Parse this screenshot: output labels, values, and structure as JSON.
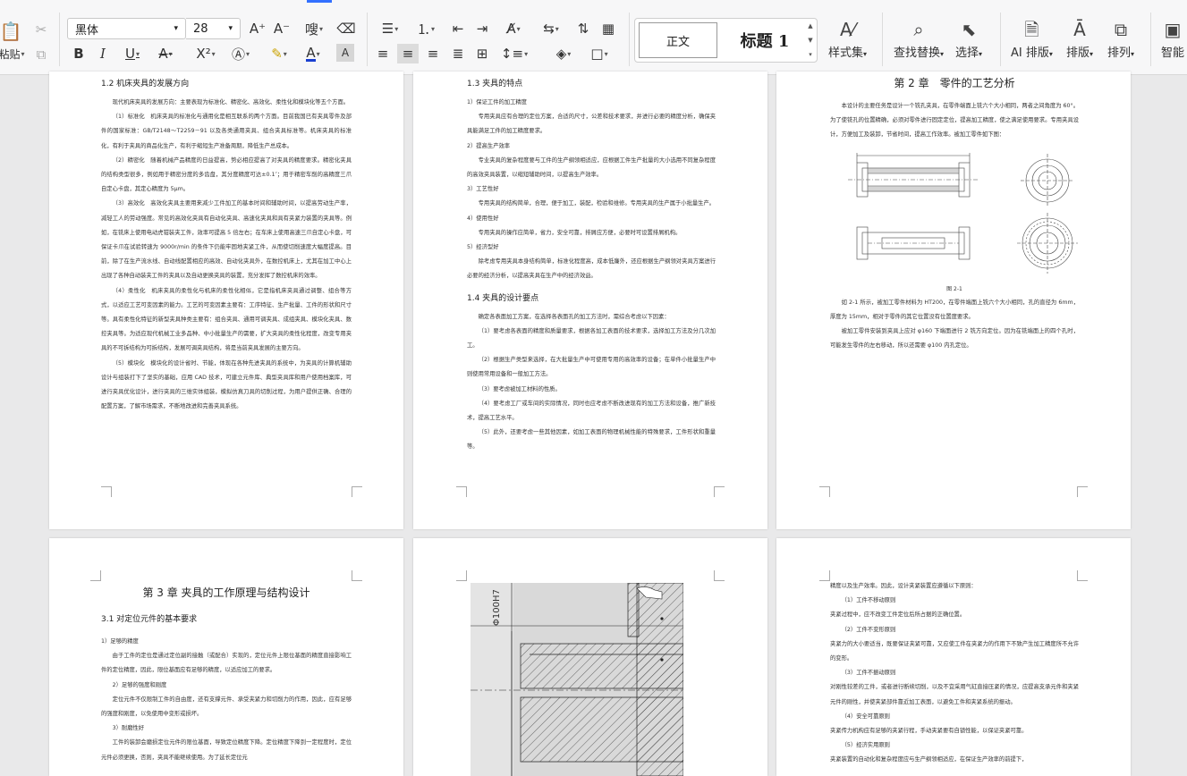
{
  "toolbar": {
    "paste_label": "粘贴",
    "font_name": "黑体",
    "font_size": "28",
    "style_normal": "正文",
    "style_heading1": "标题 1",
    "style_set_label": "样式集",
    "find_replace_label": "查找替换",
    "select_label": "选择",
    "ai_layout_label": "AI 排版",
    "layout_label": "排版",
    "arrange_label": "排列",
    "smart_label": "智能",
    "icons": [
      "cut-icon",
      "copy-icon",
      "font-grow-icon",
      "font-shrink-icon",
      "phonetic-icon",
      "clear-format-icon",
      "bold-icon",
      "italic-icon",
      "underline-icon",
      "strikethrough-icon",
      "superscript-icon",
      "text-effect-icon",
      "highlight-icon",
      "font-color-icon",
      "char-shading-icon",
      "bullet-list-icon",
      "number-list-icon",
      "outdent-icon",
      "indent-icon",
      "text-direction-icon",
      "line-spacing-icon",
      "table-icon",
      "align-left-icon",
      "align-center-icon",
      "align-right-icon",
      "justify-icon",
      "distribute-icon",
      "paragraph-spacing-icon",
      "shading-icon",
      "border-icon"
    ]
  },
  "pages": [
    {
      "id": "p1",
      "heading": "1.2 机床夹具的发展方向",
      "paragraphs": [
        "现代机床夹具的发展方向：主要表现为标准化、精密化、高效化、柔性化和模块化等五个方面。",
        "（1）标准化　机床夹具的标准化与通用化是相互联系的两个方面。目前我国已有夹具零件及部件的国家标准：GB/T2148～T2259－91 以及各类通用夹具、组合夹具标准等。机床夹具的标准化，有利于夹具的商品化生产，有利于缩短生产准备周期，降低生产总成本。",
        "（2）精密化　随着机械产品精度的日益提高，势必相应提高了对夹具的精度要求。精密化夹具的结构类型很多，例如用于精密分度的多齿盘，其分度精度可达±0.1″；用于精密车削的高精度三爪自定心卡盘，其定心精度为 5μm。",
        "（3）高效化　高效化夹具主要用来减少工件加工的基本时间和辅助时间，以提高劳动生产率，减轻工人的劳动强度。常见的高效化夹具有自动化夹具、高速化夹具和具有夹紧力装置的夹具等。例如，在铣床上使用电动虎钳装夹工件，效率可提高 5 倍左右；在车床上使用高速三爪自定心卡盘，可保证卡爪在试验转速为 9000r/min 的条件下仍能牢固地夹紧工件，从而使切削速度大幅度提高。目前，除了在生产流水线、自动线配置相应的高效、自动化夹具外，在数控机床上，尤其在加工中心上出现了各种自动装夹工件的夹具以及自动更换夹具的装置，充分发挥了数控机床的效率。",
        "（4）柔性化　机床夹具的柔性化与机床的柔性化相似，它是指机床夹具通过调整、组合等方式，以适应工艺可变因素的能力。工艺的可变因素主要有：工序特征、生产批量、工件的形状和尺寸等。具有柔性化特征的新型夹具种类主要有：组合夹具、通用可调夹具、成组夹具、模块化夹具、数控夹具等。为适应现代机械工业多品种、中小批量生产的需要，扩大夹具的柔性化程度，改变专用夹具的不可拆结构为可拆结构，发展可调夹具结构，将是当前夹具发展的主要方向。",
        "（5）模块化　模块化的设计省时、节能，体现在各种先进夹具的系统中，为夹具的计算机辅助设计与组装打下了坚实的基础，应用 CAD 技术，可建立元件库、典型夹具库和用户使用档案库，可进行夹具优化设计，进行夹具的三维实体组装，模拟仿真刀具的切削过程，为用户提供正确、合理的配置方案，了解市场需求，不断地改进和完善夹具系统。"
      ]
    },
    {
      "id": "p2",
      "heading": "1.3 夹具的特点",
      "heading2": "1.4 夹具的设计要点",
      "paragraphs": [
        "1）保证工件的加工精度",
        "专用夹具应有合理的定位方案，合适的尺寸，公差和技术要求，并进行必要的精度分析，确保夹具能满足工件的加工精度要求。",
        "2）提高生产效率",
        "专业夹具的复杂程度要与工件的生产纲领相适应，应根据工件生产批量的大小选用不同复杂程度的高效夹具装置，以缩短辅助时间，以提高生产效率。",
        "3）工艺性好",
        "专用夹具的结构简单，合理，便于加工，装配，检验和维修。专用夹具的生产属于小批量生产。",
        "4）使用性好",
        "专用夹具的操作应简单，省力，安全可靠，排屑应方便，必要时可设置排屑机构。",
        "5）经济型好",
        "除考虑专用夹具本身结构简单，标准化程度高，成本低廉外，还应根据生产纲领对夹具方案进行必要的经济分析，以提高夹具在生产中的经济效益。"
      ],
      "paragraphs2": [
        "确定各表面加工方案，在选择各表面孔的加工方法时，需综合考虑以下因素：",
        "（1）要考虑各表面的精度和质量要求，根据各加工表面的技术要求，选择加工方法及分几次加工。",
        "（2）根据生产类型来选择，在大批量生产中可使用专用的高效率的设备；在单件小批量生产中则使用常用设备和一般加工方法。",
        "（3）要考虑被加工材料的性质。",
        "（4）要考虑工厂或车间的实际情况，同时也应考虑不断改进现有的加工方法和设备，推广新技术，提高工艺水平。",
        "（5）此外，还要考虑一些其他因素，如加工表面的物理机械性能的特殊要求，工件形状和重量等。"
      ]
    },
    {
      "id": "p3",
      "heading": "第 2 章　零件的工艺分析",
      "paragraphs": [
        "本设计的主要任务是设计一个铣孔夹具，在零件端面上铣六个大小相同，两者之间角度为 60°。为了使铣孔的位置精确，必须对零件进行固定定位，提高加工精度，使之满足使用要求。专用夹具设计，方便加工及装卸，节省时间，提高工作效率。被加工零件如下图："
      ],
      "figure_caption": "图 2-1",
      "paragraphs_after": [
        "如 2-1 所示，被加工零件材料为 HT200，在零件端面上铣六个大小相同，孔的直径为 6mm，厚度为 15mm，相对于零件的其它位置没有位置度要求。",
        "被加工零件安装到夹具上应对 φ160 下端面进行 2 铣方向定位。因为在铣端面上的四个孔时，可能发生零件的左右移动，所以还需要 φ100 内孔定位。"
      ]
    },
    {
      "id": "p4",
      "heading": "第 3 章 夹具的工作原理与结构设计",
      "heading2": "3.1 对定位元件的基本要求",
      "paragraphs": [
        "1）足够的精度",
        "由于工件的定位是通过定位副的接触（或配合）实现的，定位元件上限位基面的精度直接影响工件的定位精度，因此，限位基面应有足够的精度，以适应加工的要求。",
        "2）足够的强度和刚度",
        "定位元件不仅限制工件的自由度，还有支撑元件、承受夹紧力和切削力的作用，因此，应有足够的强度和刚度，以免使用中变形或损坏。",
        "3）耐磨性好",
        "工件的装卸会磨损定位元件的限位基面，导致定位精度下降。定位精度下降到一定程度时，定位元件必须更换，否则，夹具不能继续使用。为了延长定位元"
      ]
    },
    {
      "id": "p5",
      "dimension_label": "Φ100H7"
    },
    {
      "id": "p6",
      "paragraphs": [
        "精度以及生产效率。因此，设计夹紧装置应遵循以下原则：",
        "（1）工件不移动原则",
        "夹紧过程中，应不改变工件定位后所占据的正确位置。",
        "（2）工件不变形原则",
        "夹紧力的大小要适当，既要保证夹紧可靠，又应使工件在夹紧力的作用下不致产生加工精度所不允许的变形。",
        "（3）工件不振动原则",
        "对刚性较差的工件，或者进行断续切削，以及不宜采用气缸直接压紧的情况，应提高支承元件和夹紧元件的刚性，并使夹紧部件靠近加工表面，以避免工件和夹紧系统的振动。",
        "（4）安全可靠原则",
        "夹紧传力机构应有足够的夹紧行程，手动夹紧要有自锁性能，以保证夹紧可靠。",
        "（5）经济实用原则",
        "夹紧装置的自动化和复杂程度应与生产纲领相适应，在保证生产效率的前提下，"
      ]
    }
  ]
}
